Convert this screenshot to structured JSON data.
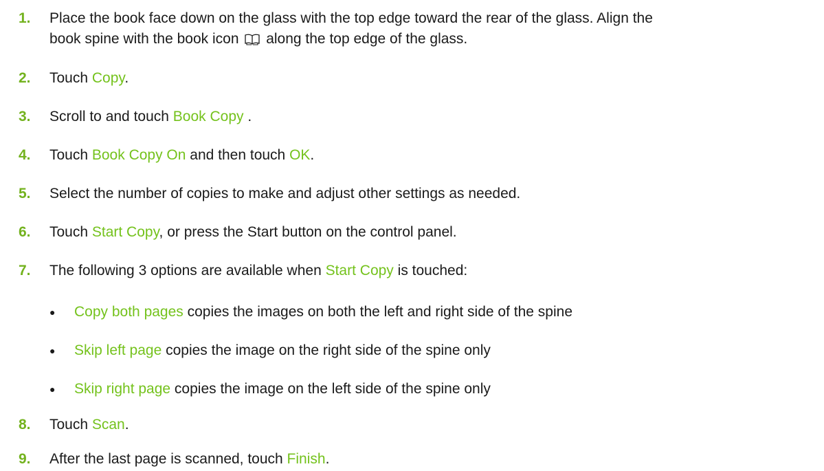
{
  "steps": [
    {
      "num": "1.",
      "line1": "Place the book face down on the glass with the top edge toward the rear of the glass. Align the",
      "line2_pre": "book spine with the book icon",
      "line2_icon": "book-icon",
      "line2_post": "along the top edge of the glass."
    },
    {
      "num": "2.",
      "pre": "Touch ",
      "ui": "Copy",
      "post": "."
    },
    {
      "num": "3.",
      "pre": "Scroll to and touch ",
      "ui": "Book Copy",
      "post": " ."
    },
    {
      "num": "4.",
      "pre": "Touch ",
      "ui": "Book Copy On",
      "mid": " and then touch ",
      "ui2": "OK",
      "post": "."
    },
    {
      "num": "5.",
      "text": "Select the number of copies to make and adjust other settings as needed."
    },
    {
      "num": "6.",
      "pre": "Touch ",
      "ui": "Start Copy",
      "post": ", or press the Start button on the control panel."
    },
    {
      "num": "7.",
      "pre": "The following 3 options are available when ",
      "ui": "Start Copy",
      "post": " is touched:"
    },
    {
      "num": "8.",
      "pre": "Touch ",
      "ui": "Scan",
      "post": "."
    },
    {
      "num": "9.",
      "pre": "After the last page is scanned, touch ",
      "ui": "Finish",
      "post": "."
    }
  ],
  "options": [
    {
      "bullet": "●",
      "ui": "Copy both pages",
      "post": " copies the images on both the left and right side of the spine"
    },
    {
      "bullet": "●",
      "ui": "Skip left page",
      "post": " copies the image on the right side of the spine only"
    },
    {
      "bullet": "●",
      "ui": "Skip right page",
      "post": " copies the image on the left side of the spine only"
    }
  ],
  "colors": {
    "number": "#73b21e",
    "ui_term": "#74c21c",
    "text": "#1a1a1a"
  }
}
